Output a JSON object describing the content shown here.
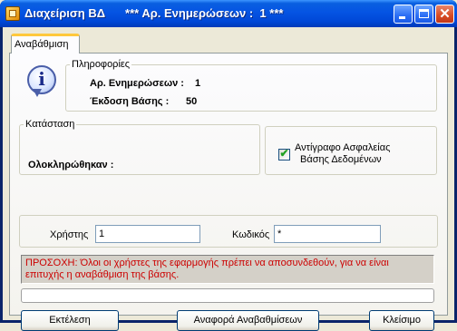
{
  "window": {
    "title": "Διαχείριση ΒΔ",
    "subtitle": "*** Αρ. Ενημερώσεων :  1 ***",
    "close_glyph": "✕"
  },
  "tabs": [
    {
      "label": "Αναβάθμιση",
      "active": true
    }
  ],
  "info_group": {
    "legend": "Πληροφορίες",
    "updates_label": "Αρ. Ενημερώσεων :",
    "updates_value": "1",
    "version_label": "Έκδοση Βάσης :",
    "version_value": "50"
  },
  "status_group": {
    "legend": "Κατάσταση",
    "completed_label": "Ολοκληρώθηκαν :"
  },
  "backup": {
    "line1": "Αντίγραφο Ασφαλείας",
    "line2": "Βάσης Δεδομένων",
    "checked": true,
    "check_glyph": "✔"
  },
  "login": {
    "user_label": "Χρήστης",
    "user_value": "1",
    "password_label": "Κωδικός",
    "password_value": "*"
  },
  "warning": {
    "line1": "ΠΡΟΣΟΧΗ:  Όλοι οι χρήστες της εφαρμογής πρέπει να αποσυνδεθούν, για να είναι",
    "line2": "επιτυχής η αναβάθμιση της βάσης."
  },
  "buttons": {
    "execute": "Εκτέλεση",
    "report": "Αναφορά Αναβαθμίσεων",
    "close": "Κλείσιμο"
  },
  "colors": {
    "titlebar": "#0554e3",
    "warning_text": "#cc0000",
    "tab_accent": "#ffc83c"
  }
}
